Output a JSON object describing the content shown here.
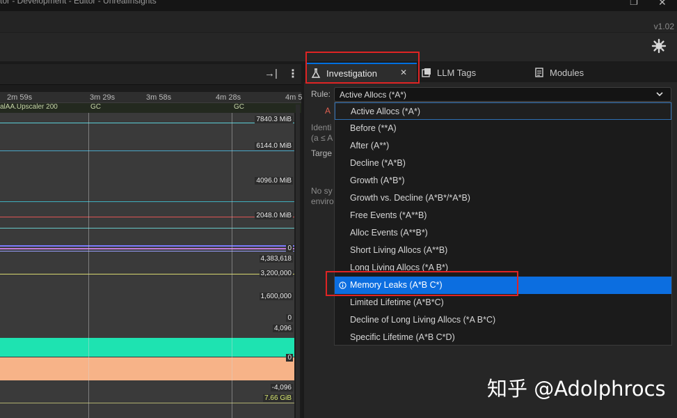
{
  "window": {
    "title": "tor - Development - Editor - UnrealInsights",
    "version": "v1.02"
  },
  "timeline": {
    "ruler_labels": [
      "2m 59s",
      "3m 29s",
      "3m 58s",
      "4m 28s",
      "4m 5"
    ],
    "event_labels": [
      "alAA.Upscaler 200",
      "GC",
      "GC"
    ],
    "value_labels": [
      "7840.3 MiB",
      "6144.0 MiB",
      "4096.0 MiB",
      "2048.0 MiB",
      "0",
      "4,383,618",
      "3,200,000",
      "1,600,000",
      "0",
      "4,096",
      "0",
      "-4,096",
      "7.66 GiB"
    ],
    "colors": {
      "cyan_band": "#1ee3b1",
      "orange_band": "#f7b388"
    }
  },
  "tabs": [
    {
      "label": "Investigation",
      "icon": "flask-icon"
    },
    {
      "label": "LLM Tags",
      "icon": "tags-icon"
    },
    {
      "label": "Modules",
      "icon": "modules-icon"
    }
  ],
  "investigation": {
    "rule_label": "Rule:",
    "rule_value": "Active Allocs (*A*)",
    "marker_text": "A",
    "background_text": [
      "Identi",
      "(a ≤ A",
      "Targe",
      "No sy",
      "enviro"
    ]
  },
  "dropdown": {
    "options": [
      "Active Allocs (*A*)",
      "Before (**A)",
      "After (A**)",
      "Decline (*A*B)",
      "Growth (A*B*)",
      "Growth vs. Decline (A*B*/*A*B)",
      "Free Events (*A**B)",
      "Alloc Events (A**B*)",
      "Short Living Allocs (A**B)",
      "Long Living Allocs (*A B*)",
      "Memory Leaks (A*B C*)",
      "Limited Lifetime (A*B*C)",
      "Decline of Long Living Allocs (*A B*C)",
      "Specific Lifetime (A*B C*D)"
    ],
    "selected": "Memory Leaks (A*B C*)",
    "accent_color": "#0c6ee0"
  },
  "watermark": "知乎 @Adolphrocs"
}
